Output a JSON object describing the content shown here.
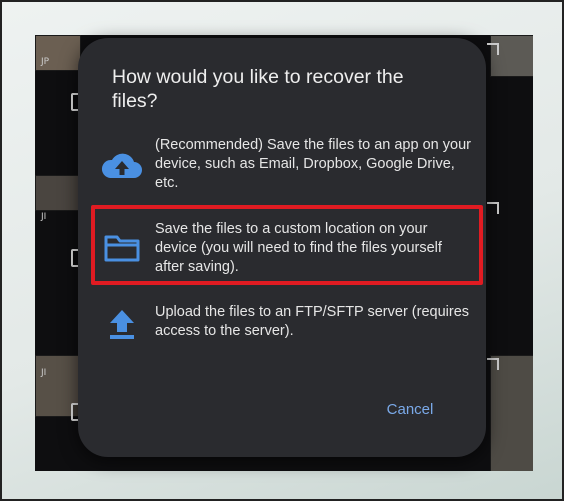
{
  "background": {
    "thumb_labels": [
      "JP",
      "JI",
      "JI"
    ]
  },
  "dialog": {
    "title": "How would you like to recover the files?",
    "options": [
      {
        "icon": "cloud-upload-icon",
        "text": "(Recommended) Save the files to an app on your device, such as Email, Dropbox, Google Drive, etc."
      },
      {
        "icon": "folder-icon",
        "text": "Save the files to a custom location on your device (you will need to find the files yourself after saving)."
      },
      {
        "icon": "upload-arrow-icon",
        "text": "Upload the files to an FTP/SFTP server (requires access to the server)."
      }
    ],
    "cancel_label": "Cancel"
  },
  "colors": {
    "dialog_bg": "#2a2b2f",
    "icon_blue": "#4a90e2",
    "accent_link": "#7aa9e8",
    "highlight_red": "#e01b22"
  }
}
